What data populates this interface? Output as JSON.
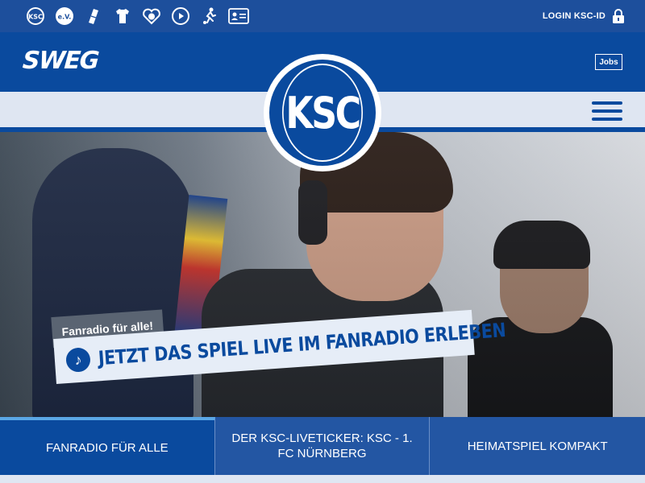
{
  "topbar": {
    "icons": [
      "ksc-logo-icon",
      "ev-icon",
      "tickets-icon",
      "jersey-icon",
      "heart-icon",
      "play-icon",
      "player-icon",
      "id-card-icon"
    ],
    "ev_label": "e.V.",
    "login_label": "LOGIN KSC-ID"
  },
  "header": {
    "sponsor": "SWEG",
    "jobs_label": "Jobs",
    "logo_text": "KSC"
  },
  "hero": {
    "tag": "Fanradio für alle!",
    "headline": "JETZT DAS SPIEL LIVE IM FANRADIO ERLEBEN"
  },
  "tabs": [
    {
      "label": "FANRADIO FÜR ALLE",
      "active": true
    },
    {
      "label": "DER KSC-LIVETICKER: KSC - 1. FC NÜRNBERG",
      "active": false
    },
    {
      "label": "HEIMATSPIEL KOMPAKT",
      "active": false
    }
  ],
  "colors": {
    "primary": "#0a4a9e",
    "topbar": "#1d4f9c",
    "light": "#e6edf7"
  }
}
